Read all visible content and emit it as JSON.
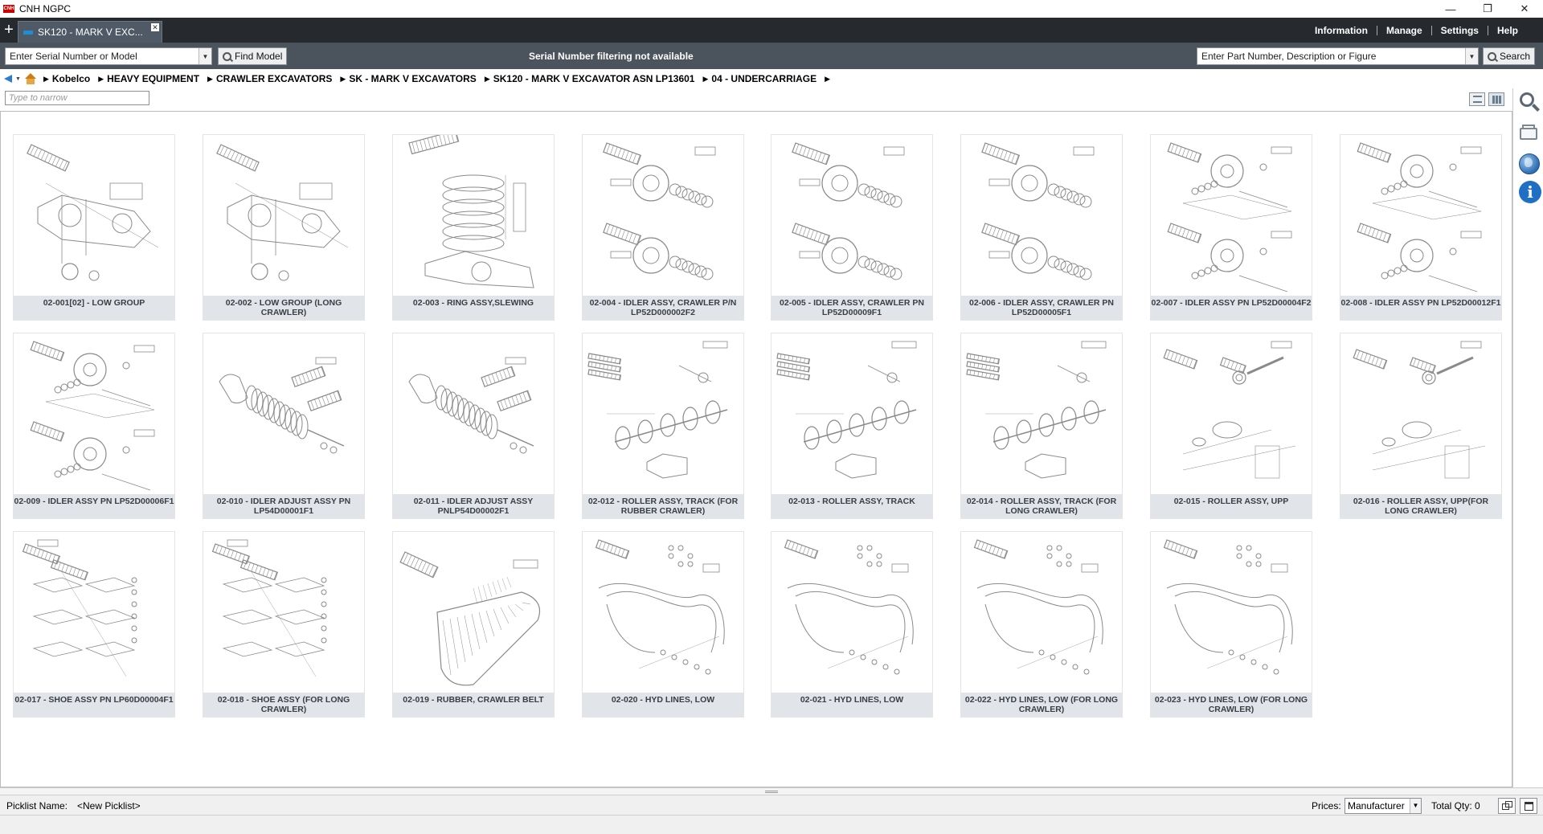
{
  "window": {
    "logo_text": "CNH",
    "title": "CNH NGPC",
    "controls": [
      "—",
      "❐",
      "✕"
    ]
  },
  "tabbar": {
    "new_tab_icon": "plus-icon",
    "active_tab": "SK120 - MARK V EXC..."
  },
  "top_menu": [
    "Information",
    "Manage",
    "Settings",
    "Help"
  ],
  "toolbar": {
    "model_placeholder": "Enter Serial Number or Model",
    "find_model_label": "Find Model",
    "serial_status": "Serial Number filtering not available",
    "part_placeholder": "Enter Part Number, Description or Figure",
    "search_label": "Search"
  },
  "breadcrumb": [
    "Kobelco",
    "HEAVY EQUIPMENT",
    "CRAWLER EXCAVATORS",
    "SK - MARK V EXCAVATORS",
    "SK120 - MARK V EXCAVATOR ASN LP13601",
    "04 - UNDERCARRIAGE"
  ],
  "narrow": {
    "placeholder": "Type to narrow"
  },
  "figures": [
    {
      "label": "02-001[02] - LOW GROUP",
      "kind": "frame"
    },
    {
      "label": "02-002 - LOW GROUP (LONG CRAWLER)",
      "kind": "frame"
    },
    {
      "label": "02-003 - RING ASSY,SLEWING",
      "kind": "ring"
    },
    {
      "label": "02-004 - IDLER ASSY, CRAWLER P/N LP52D000002F2",
      "kind": "idler"
    },
    {
      "label": "02-005 - IDLER ASSY, CRAWLER PN LP52D00009F1",
      "kind": "idler"
    },
    {
      "label": "02-006 - IDLER ASSY, CRAWLER PN LP52D00005F1",
      "kind": "idler"
    },
    {
      "label": "02-007 - IDLER ASSY PN LP52D00004F2",
      "kind": "idler2"
    },
    {
      "label": "02-008 - IDLER ASSY PN LP52D00012F1",
      "kind": "idler2"
    },
    {
      "label": "02-009 - IDLER ASSY PN LP52D00006F1",
      "kind": "idler2"
    },
    {
      "label": "02-010 - IDLER ADJUST ASSY PN LP54D00001F1",
      "kind": "adjust"
    },
    {
      "label": "02-011 - IDLER ADJUST ASSY PNLP54D00002F1",
      "kind": "adjust"
    },
    {
      "label": "02-012 - ROLLER ASSY, TRACK (FOR RUBBER CRAWLER)",
      "kind": "roller"
    },
    {
      "label": "02-013 - ROLLER ASSY, TRACK",
      "kind": "roller"
    },
    {
      "label": "02-014 - ROLLER ASSY, TRACK (FOR LONG CRAWLER)",
      "kind": "roller"
    },
    {
      "label": "02-015 - ROLLER ASSY, UPP",
      "kind": "upper"
    },
    {
      "label": "02-016 - ROLLER ASSY, UPP(FOR LONG CRAWLER)",
      "kind": "upper"
    },
    {
      "label": "02-017 - SHOE ASSY PN LP60D00004F1",
      "kind": "shoe"
    },
    {
      "label": "02-018 - SHOE ASSY (FOR LONG CRAWLER)",
      "kind": "shoe"
    },
    {
      "label": "02-019 - RUBBER, CRAWLER BELT",
      "kind": "belt"
    },
    {
      "label": "02-020 - HYD LINES, LOW",
      "kind": "hyd"
    },
    {
      "label": "02-021 - HYD LINES, LOW",
      "kind": "hyd"
    },
    {
      "label": "02-022 - HYD LINES, LOW (FOR LONG CRAWLER)",
      "kind": "hyd"
    },
    {
      "label": "02-023 - HYD LINES, LOW (FOR LONG CRAWLER)",
      "kind": "hyd"
    }
  ],
  "sidebar_icons": [
    "search-icon",
    "picklist-icon",
    "globe-icon",
    "info-icon"
  ],
  "picklist": {
    "name_label": "Picklist Name:",
    "name_value": "<New Picklist>",
    "prices_label": "Prices:",
    "prices_value": "Manufacturer",
    "total_qty": "Total Qty: 0"
  }
}
